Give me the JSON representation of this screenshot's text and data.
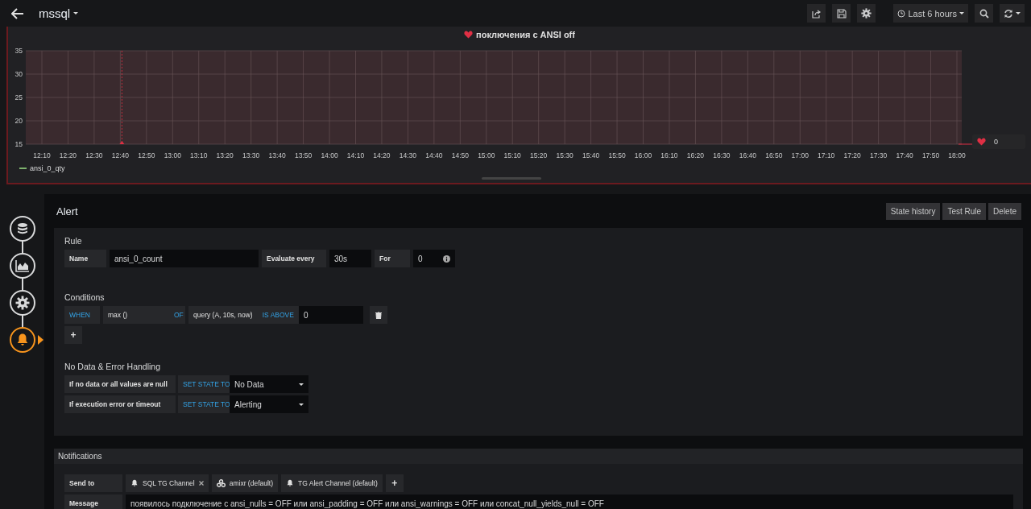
{
  "topbar": {
    "dashboard": "mssql",
    "time_range": "Last 6 hours"
  },
  "panel": {
    "title": "поключения с ANSI off",
    "alerting": true,
    "hover_value": "0",
    "chart_data": {
      "type": "line",
      "ylim": [
        15,
        35
      ],
      "yticks": [
        15,
        20,
        25,
        30,
        35
      ],
      "grid": true,
      "categories": [
        "12:10",
        "12:20",
        "12:30",
        "12:40",
        "12:50",
        "13:00",
        "13:10",
        "13:20",
        "13:30",
        "13:40",
        "13:50",
        "14:00",
        "14:10",
        "14:20",
        "14:30",
        "14:40",
        "14:50",
        "15:00",
        "15:10",
        "15:20",
        "15:30",
        "15:40",
        "15:50",
        "16:00",
        "16:10",
        "16:20",
        "16:30",
        "16:40",
        "16:50",
        "17:00",
        "17:10",
        "17:20",
        "17:30",
        "17:40",
        "17:50",
        "18:00"
      ],
      "series": [
        {
          "name": "ansi_0_qty",
          "color": "#7eb26d",
          "values": [
            null,
            null,
            null,
            null,
            null,
            null,
            null,
            null,
            null,
            null,
            null,
            null,
            null,
            null,
            null,
            null,
            null,
            null,
            null,
            null,
            null,
            null,
            null,
            null,
            null,
            null,
            null,
            null,
            null,
            null,
            null,
            null,
            null,
            null,
            null,
            null
          ]
        }
      ],
      "ref_lines": [
        {
          "axis": "x",
          "value": "12:40",
          "color": "#e02f44"
        }
      ]
    }
  },
  "sidebar": [
    {
      "kind": "database",
      "selected": false
    },
    {
      "kind": "chart",
      "selected": false
    },
    {
      "kind": "gear",
      "selected": false
    },
    {
      "kind": "bell",
      "selected": true
    }
  ],
  "alert": {
    "title": "Alert",
    "buttons": [
      "State history",
      "Test Rule",
      "Delete"
    ],
    "rule": {
      "heading": "Rule",
      "name_label": "Name",
      "name": "ansi_0_count",
      "evaluate_label": "Evaluate every",
      "evaluate": "30s",
      "for_label": "For",
      "for": "0"
    },
    "conditions": {
      "heading": "Conditions",
      "when": "WHEN",
      "reducer": "max ()",
      "of": "OF",
      "query": "query (A, 10s, now)",
      "evaluator": "IS ABOVE",
      "threshold": "0",
      "add": "+"
    },
    "handling": {
      "heading": "No Data & Error Handling",
      "rows": [
        {
          "label": "If no data or all values are null",
          "action": "SET STATE TO",
          "value": "No Data"
        },
        {
          "label": "If execution error or timeout",
          "action": "SET STATE TO",
          "value": "Alerting"
        }
      ]
    }
  },
  "notifications": {
    "heading": "Notifications",
    "send_label": "Send to",
    "channels": [
      {
        "kind": "bell",
        "name": "SQL TG Channel",
        "removable": true
      },
      {
        "kind": "cluster",
        "name": "amixr (default)",
        "removable": false
      },
      {
        "kind": "bell",
        "name": "TG Alert Channel (default)",
        "removable": false
      }
    ],
    "add": "+",
    "message_label": "Message",
    "message": "появилось подключение с ansi_nulls = OFF или ansi_padding = OFF или ansi_warnings = OFF или concat_null_yields_null = OFF"
  }
}
